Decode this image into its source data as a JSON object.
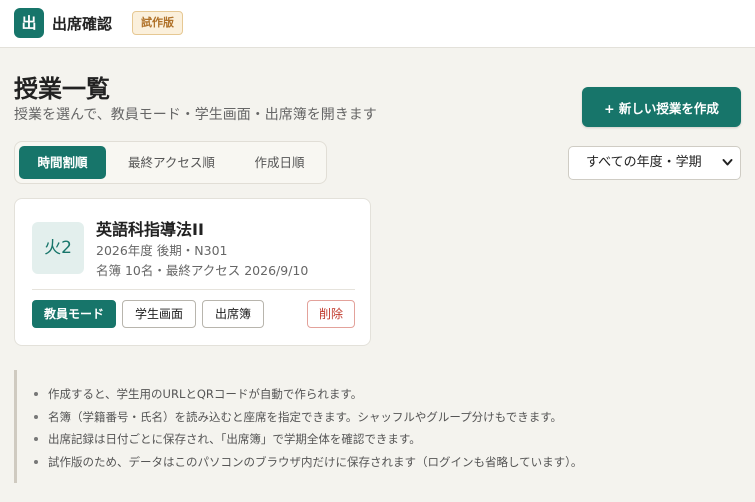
{
  "header": {
    "logo_char": "出",
    "app_title": "出席確認",
    "badge": "試作版"
  },
  "page": {
    "title": "授業一覧",
    "subtitle": "授業を選んで、教員モード・学生画面・出席簿を開きます",
    "new_button": "+ 新しい授業を作成"
  },
  "sort_tabs": [
    {
      "label": "時間割順",
      "active": true
    },
    {
      "label": "最終アクセス順",
      "active": false
    },
    {
      "label": "作成日順",
      "active": false
    }
  ],
  "filter": {
    "selected": "すべての年度・学期"
  },
  "course": {
    "period": "火2",
    "name": "英語科指導法II",
    "meta": "2026年度 後期・N301",
    "info": "名簿 10名・最終アクセス 2026/9/10",
    "buttons": {
      "teacher": "教員モード",
      "student": "学生画面",
      "roster": "出席簿",
      "delete": "削除"
    }
  },
  "notes": [
    "作成すると、学生用のURLとQRコードが自動で作られます。",
    "名簿（学籍番号・氏名）を読み込むと座席を指定できます。シャッフルやグループ分けもできます。",
    "出席記録は日付ごとに保存され、「出席簿」で学期全体を確認できます。",
    "試作版のため、データはこのパソコンのブラウザ内だけに保存されます（ログインも省略しています）。"
  ],
  "colors": {
    "accent": "#17756a",
    "badge_bg": "#fbf0dc",
    "badge_text": "#b0722a",
    "danger": "#c0392b"
  }
}
